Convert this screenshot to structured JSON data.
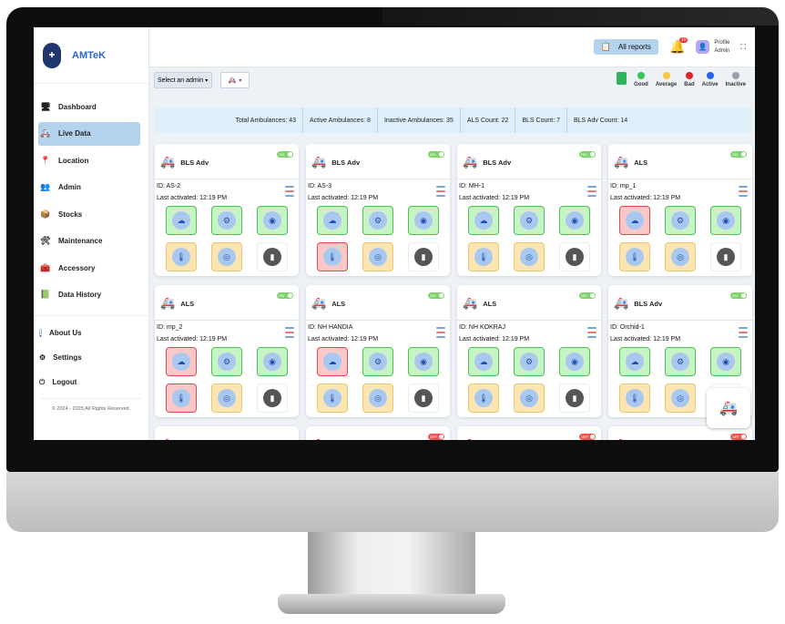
{
  "app": {
    "name": "AMTeK",
    "logo_text": "Amtek"
  },
  "sidebar": {
    "items": [
      {
        "label": "Dashboard",
        "icon": "dashboard-icon",
        "glyph": "🖥",
        "active": false
      },
      {
        "label": "Live Data",
        "icon": "ambulance-icon",
        "glyph": "🚑",
        "active": true
      },
      {
        "label": "Location",
        "icon": "map-pin-icon",
        "glyph": "📍",
        "active": false
      },
      {
        "label": "Admin",
        "icon": "admin-users-icon",
        "glyph": "👥",
        "active": false
      },
      {
        "label": "Stocks",
        "icon": "stocks-icon",
        "glyph": "📦",
        "active": false
      },
      {
        "label": "Maintenance",
        "icon": "wrench-icon",
        "glyph": "🛠",
        "active": false
      },
      {
        "label": "Accessory",
        "icon": "toolbox-icon",
        "glyph": "🧰",
        "active": false
      },
      {
        "label": "Data History",
        "icon": "history-icon",
        "glyph": "📗",
        "active": false
      }
    ],
    "secondary": [
      {
        "label": "About Us",
        "icon": "info-icon",
        "glyph": "ℹ"
      },
      {
        "label": "Settings",
        "icon": "gear-icon",
        "glyph": "⚙"
      },
      {
        "label": "Logout",
        "icon": "power-icon",
        "glyph": "⏻"
      }
    ],
    "copyright": "© 2024 - 2025,All Rights Reserved."
  },
  "header": {
    "reports_label": "All reports",
    "notification_count": "10",
    "profile_label": "Profile",
    "profile_role": "Admin"
  },
  "toolbar": {
    "admin_select": "Select an admin",
    "vehicle_select_icon": "ambulance-icon"
  },
  "legend": [
    {
      "label": "Good",
      "color": "#34c759"
    },
    {
      "label": "Average",
      "color": "#f7c948"
    },
    {
      "label": "Bad",
      "color": "#e02424"
    },
    {
      "label": "Active",
      "color": "#2563eb"
    },
    {
      "label": "Inactive",
      "color": "#9aa0a6"
    }
  ],
  "stats": {
    "total": "Total Ambulances: 43",
    "active": "Active Ambulances: 8",
    "inactive": "Inactive Ambulances: 35",
    "als": "ALS Count: 22",
    "bls": "BLS Count: 7",
    "bls_adv": "BLS Adv Count: 14"
  },
  "cards": [
    {
      "type": "BLS Adv",
      "id": "ID: AS-2",
      "last": "Last activated: 12:19 PM",
      "toggle": "ON",
      "sensors": [
        "good",
        "good",
        "good",
        "average",
        "average",
        "neutral"
      ]
    },
    {
      "type": "BLS Adv",
      "id": "ID: AS-3",
      "last": "Last activated: 12:19 PM",
      "toggle": "ON",
      "sensors": [
        "good",
        "good",
        "good",
        "bad",
        "average",
        "neutral"
      ]
    },
    {
      "type": "BLS Adv",
      "id": "ID: MH-1",
      "last": "Last activated: 12:19 PM",
      "toggle": "ON",
      "sensors": [
        "good",
        "good",
        "good",
        "average",
        "average",
        "neutral"
      ]
    },
    {
      "type": "ALS",
      "id": "ID: mp_1",
      "last": "Last activated: 12:19 PM",
      "toggle": "ON",
      "sensors": [
        "bad",
        "good",
        "good",
        "average",
        "average",
        "neutral"
      ]
    },
    {
      "type": "ALS",
      "id": "ID: mp_2",
      "last": "Last activated: 12:19 PM",
      "toggle": "ON",
      "sensors": [
        "bad",
        "good",
        "good",
        "bad",
        "average",
        "neutral"
      ]
    },
    {
      "type": "ALS",
      "id": "ID: NH HANDIA",
      "last": "Last activated: 12:19 PM",
      "toggle": "ON",
      "sensors": [
        "bad",
        "good",
        "good",
        "average",
        "average",
        "neutral"
      ]
    },
    {
      "type": "ALS",
      "id": "ID: NH KOKRAJ",
      "last": "Last activated: 12:19 PM",
      "toggle": "ON",
      "sensors": [
        "good",
        "good",
        "good",
        "average",
        "average",
        "neutral"
      ]
    },
    {
      "type": "BLS Adv",
      "id": "ID: Orchid-1",
      "last": "Last activated: 12:19 PM",
      "toggle": "ON",
      "sensors": [
        "good",
        "good",
        "good",
        "average",
        "average",
        "neutral"
      ]
    },
    {
      "type": "",
      "id": "",
      "last": "",
      "toggle": "",
      "sensors": []
    },
    {
      "type": "",
      "id": "",
      "last": "",
      "toggle": "OFF",
      "sensors": []
    },
    {
      "type": "",
      "id": "",
      "last": "",
      "toggle": "OFF",
      "sensors": []
    },
    {
      "type": "",
      "id": "",
      "last": "",
      "toggle": "OFF",
      "sensors": []
    }
  ]
}
